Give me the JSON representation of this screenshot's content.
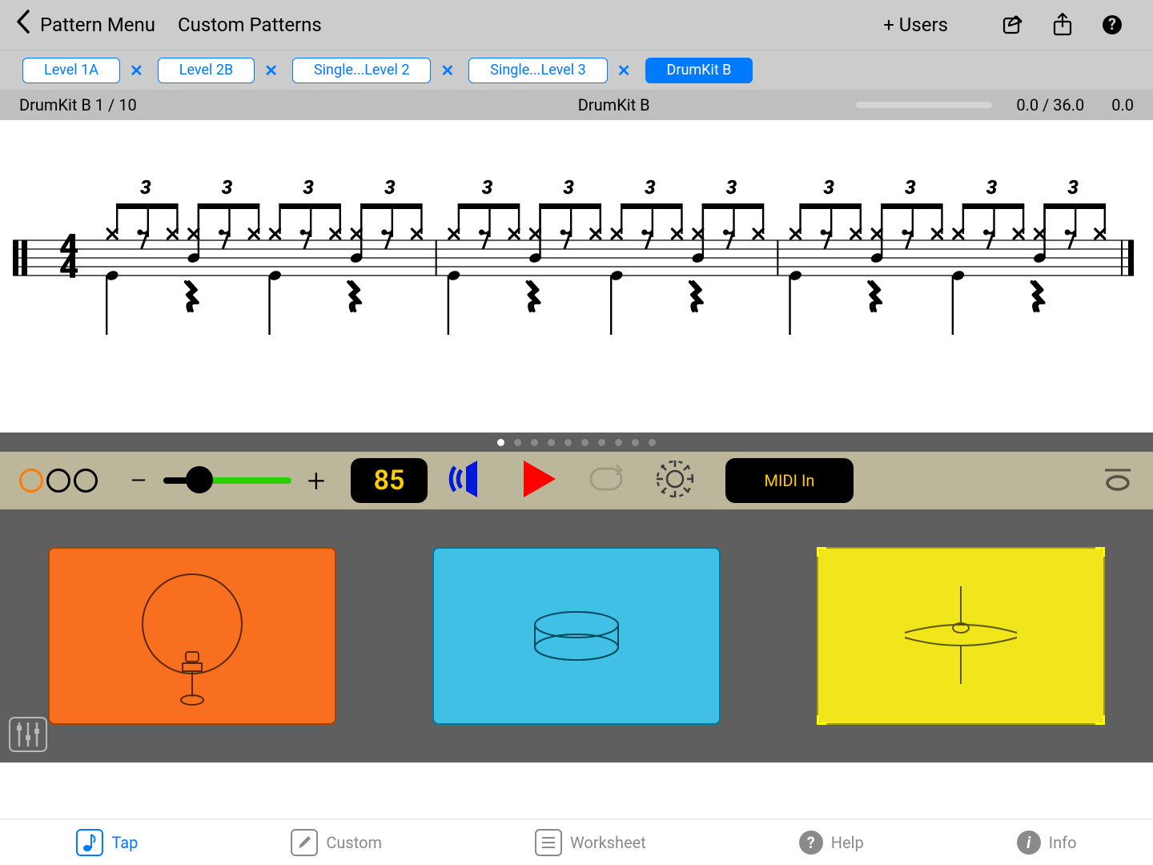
{
  "header": {
    "back_label": "Pattern Menu",
    "title": "Custom Patterns",
    "users_label": "+ Users"
  },
  "tabs": {
    "items": [
      {
        "label": "Level 1A",
        "closable": true,
        "active": false
      },
      {
        "label": "Level 2B",
        "closable": true,
        "active": false
      },
      {
        "label": "Single...Level 2",
        "closable": true,
        "active": false
      },
      {
        "label": "Single...Level 3",
        "closable": true,
        "active": false
      },
      {
        "label": "DrumKit B",
        "closable": false,
        "active": true
      }
    ]
  },
  "status": {
    "left": "DrumKit B 1 / 10",
    "center": "DrumKit B",
    "score": "0.0 / 36.0",
    "right": "0.0"
  },
  "notation": {
    "time_sig_top": "4",
    "time_sig_bottom": "4",
    "triplet_label": "3",
    "measures": 3,
    "groups_per_measure": 4
  },
  "controls": {
    "page_dots": 10,
    "page_active": 0,
    "beads": 3,
    "minus": "−",
    "plus": "+",
    "tempo": "85",
    "midi_label": "MIDI In"
  },
  "pads": [
    {
      "name": "kick",
      "color": "orange"
    },
    {
      "name": "snare",
      "color": "blue"
    },
    {
      "name": "hihat",
      "color": "yellow"
    }
  ],
  "bottom": {
    "items": [
      {
        "label": "Tap",
        "icon": "note",
        "active": true
      },
      {
        "label": "Custom",
        "icon": "pencil",
        "active": false
      },
      {
        "label": "Worksheet",
        "icon": "lines",
        "active": false
      },
      {
        "label": "Help",
        "icon": "question",
        "active": false
      },
      {
        "label": "Info",
        "icon": "info",
        "active": false
      }
    ]
  }
}
